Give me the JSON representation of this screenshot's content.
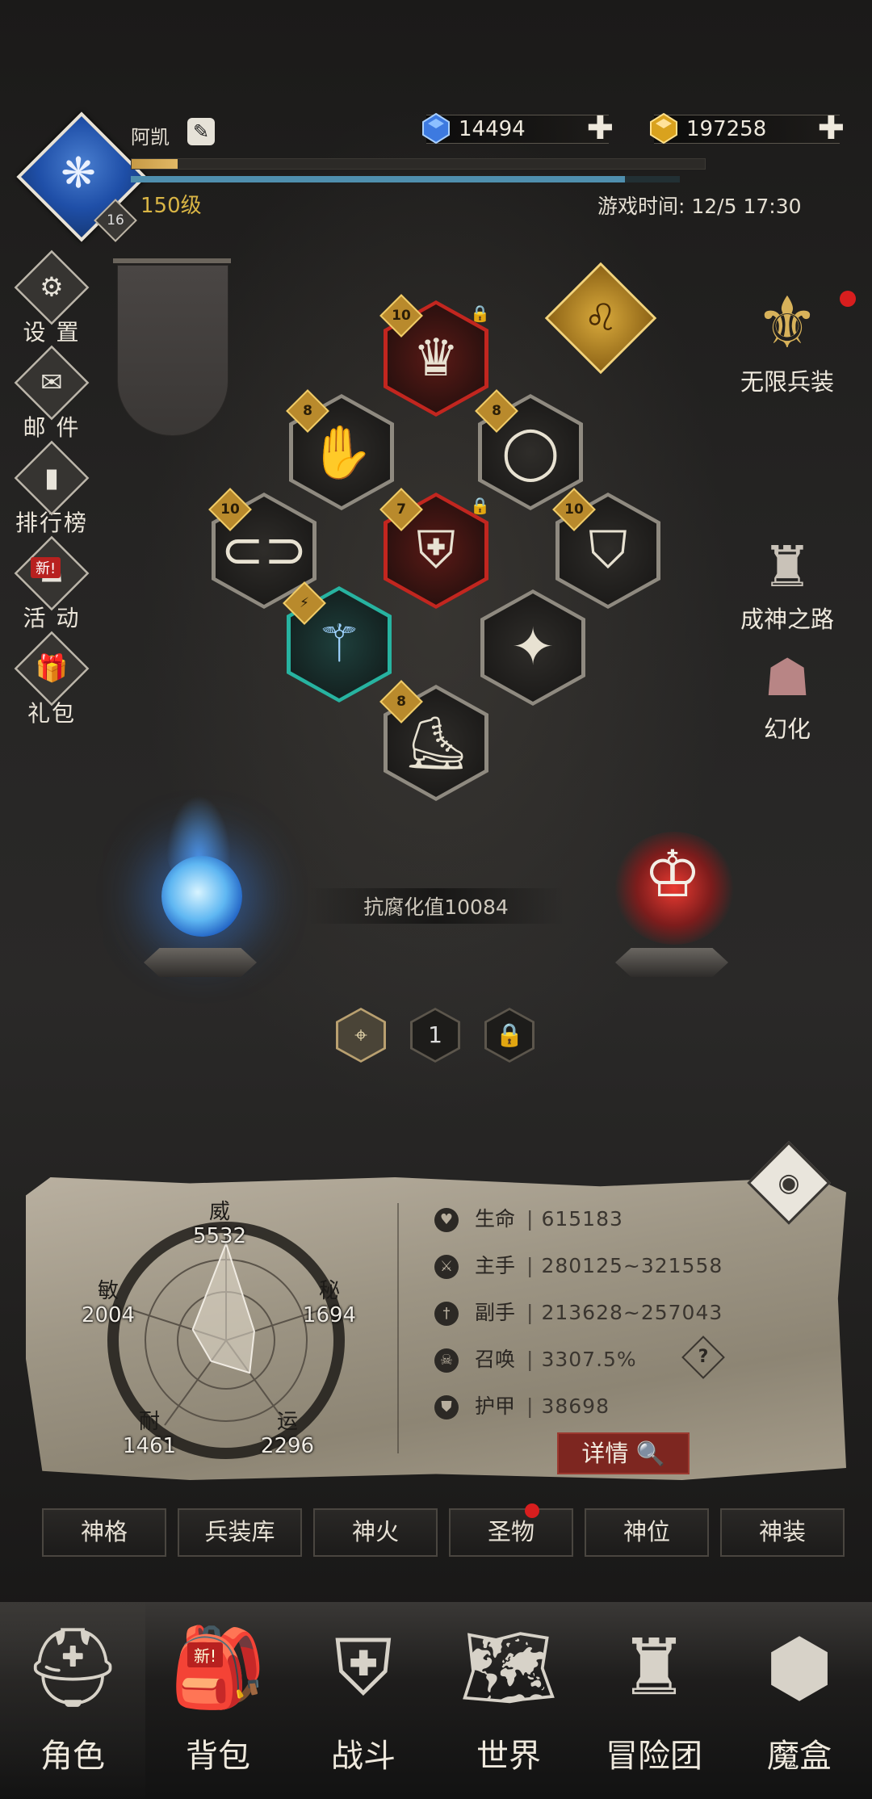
{
  "header": {
    "player_name": "阿凯",
    "avatar_level_badge": "16",
    "level_text": "150级",
    "exp_progress": 0.08,
    "bar2_progress": 0.9,
    "game_time_label": "游戏时间: 12/5 17:30",
    "currency_blue": "14494",
    "currency_gold": "197258",
    "plus_symbol": "✚"
  },
  "left_menu": [
    {
      "label": "设 置",
      "icon": "gear-icon"
    },
    {
      "label": "邮 件",
      "icon": "mail-icon"
    },
    {
      "label": "排行榜",
      "icon": "ranking-icon"
    },
    {
      "label": "活 动",
      "icon": "event-icon",
      "badge": "新!"
    },
    {
      "label": "礼包",
      "icon": "gift-icon"
    }
  ],
  "right_menu": [
    {
      "label": "无限兵装",
      "icon": "winged-sword-icon",
      "dot": true
    },
    {
      "label": "成神之路",
      "icon": "winged-helmet-icon"
    },
    {
      "label": "幻化",
      "icon": "hooded-head-icon"
    }
  ],
  "equipment": {
    "crown_tier": "10",
    "gauntlet_tier": "8",
    "ring_tier": "8",
    "belt_tier": "10",
    "armor_tier": "7",
    "cape_tier": "10",
    "boots_tier": "8"
  },
  "resist_label": "抗腐化值10084",
  "pager": {
    "middle": "1"
  },
  "radar": {
    "wei_label": "威",
    "wei_value": "5532",
    "mi_label": "秘",
    "mi_value": "1694",
    "yun_label": "运",
    "yun_value": "2296",
    "nai_label": "耐",
    "nai_value": "1461",
    "min_label": "敏",
    "min_value": "2004"
  },
  "stats": [
    {
      "label": "生命",
      "value": "615183"
    },
    {
      "label": "主手",
      "value": "280125~321558"
    },
    {
      "label": "副手",
      "value": "213628~257043"
    },
    {
      "label": "召唤",
      "value": "3307.5%"
    },
    {
      "label": "护甲",
      "value": "38698"
    }
  ],
  "stat_separator": "|",
  "help_symbol": "?",
  "detail_button": "详情",
  "tabs": [
    "神格",
    "兵装库",
    "神火",
    "圣物",
    "神位",
    "神装"
  ],
  "bottom_nav": [
    {
      "label": "角色",
      "icon": "helmet-icon"
    },
    {
      "label": "背包",
      "icon": "backpack-icon",
      "badge": "新!"
    },
    {
      "label": "战斗",
      "icon": "shield-sword-icon"
    },
    {
      "label": "世界",
      "icon": "world-map-icon"
    },
    {
      "label": "冒险团",
      "icon": "castle-icon"
    },
    {
      "label": "魔盒",
      "icon": "magic-cube-icon"
    }
  ]
}
